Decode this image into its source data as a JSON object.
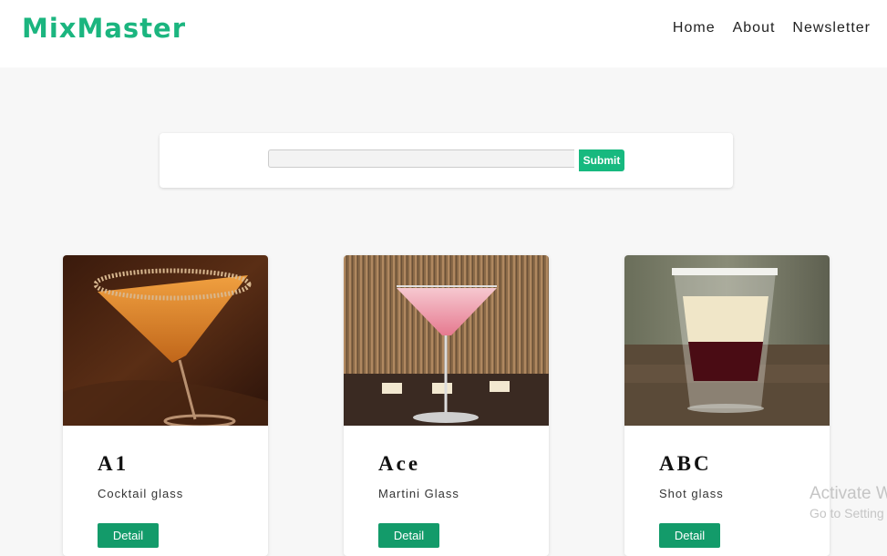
{
  "header": {
    "logo": "MixMaster",
    "nav": [
      "Home",
      "About",
      "Newsletter"
    ]
  },
  "search": {
    "value": "",
    "placeholder": "",
    "submit_label": "Submit"
  },
  "cards": [
    {
      "name": "A1",
      "glass": "Cocktail glass",
      "button": "Detail",
      "image": "orange-martini-cocktail-photo"
    },
    {
      "name": "Ace",
      "glass": "Martini Glass",
      "button": "Detail",
      "image": "pink-martini-cocktail-photo"
    },
    {
      "name": "ABC",
      "glass": "Shot glass",
      "button": "Detail",
      "image": "layered-shot-glass-photo"
    }
  ],
  "watermark": {
    "line1": "Activate W",
    "line2": "Go to Setting"
  },
  "colors": {
    "accent": "#1bb57f",
    "button": "#139b6a",
    "background": "#f7f7f7"
  }
}
